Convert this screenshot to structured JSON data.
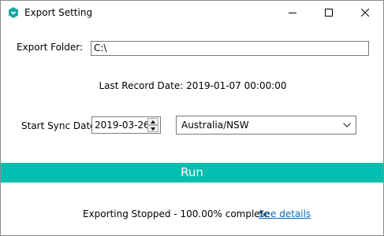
{
  "window": {
    "title": "Export Setting",
    "icon": "hexagon-app-icon",
    "controls": [
      "minimize-icon",
      "maximize-icon",
      "close-icon"
    ]
  },
  "export_folder": {
    "label": "Export Folder:",
    "value": "C:\\"
  },
  "last_record": {
    "text": "Last Record Date: 2019-01-07 00:00:00"
  },
  "start_sync": {
    "label": "Start Sync Date:",
    "date_value": "2019-03-26",
    "timezone_value": "Australia/NSW"
  },
  "run_button": {
    "label": "Run",
    "color": "#00bfb0"
  },
  "status": {
    "text": "Exporting Stopped - 100.00% complete",
    "progress_percent": 100,
    "link_label": "See details"
  }
}
